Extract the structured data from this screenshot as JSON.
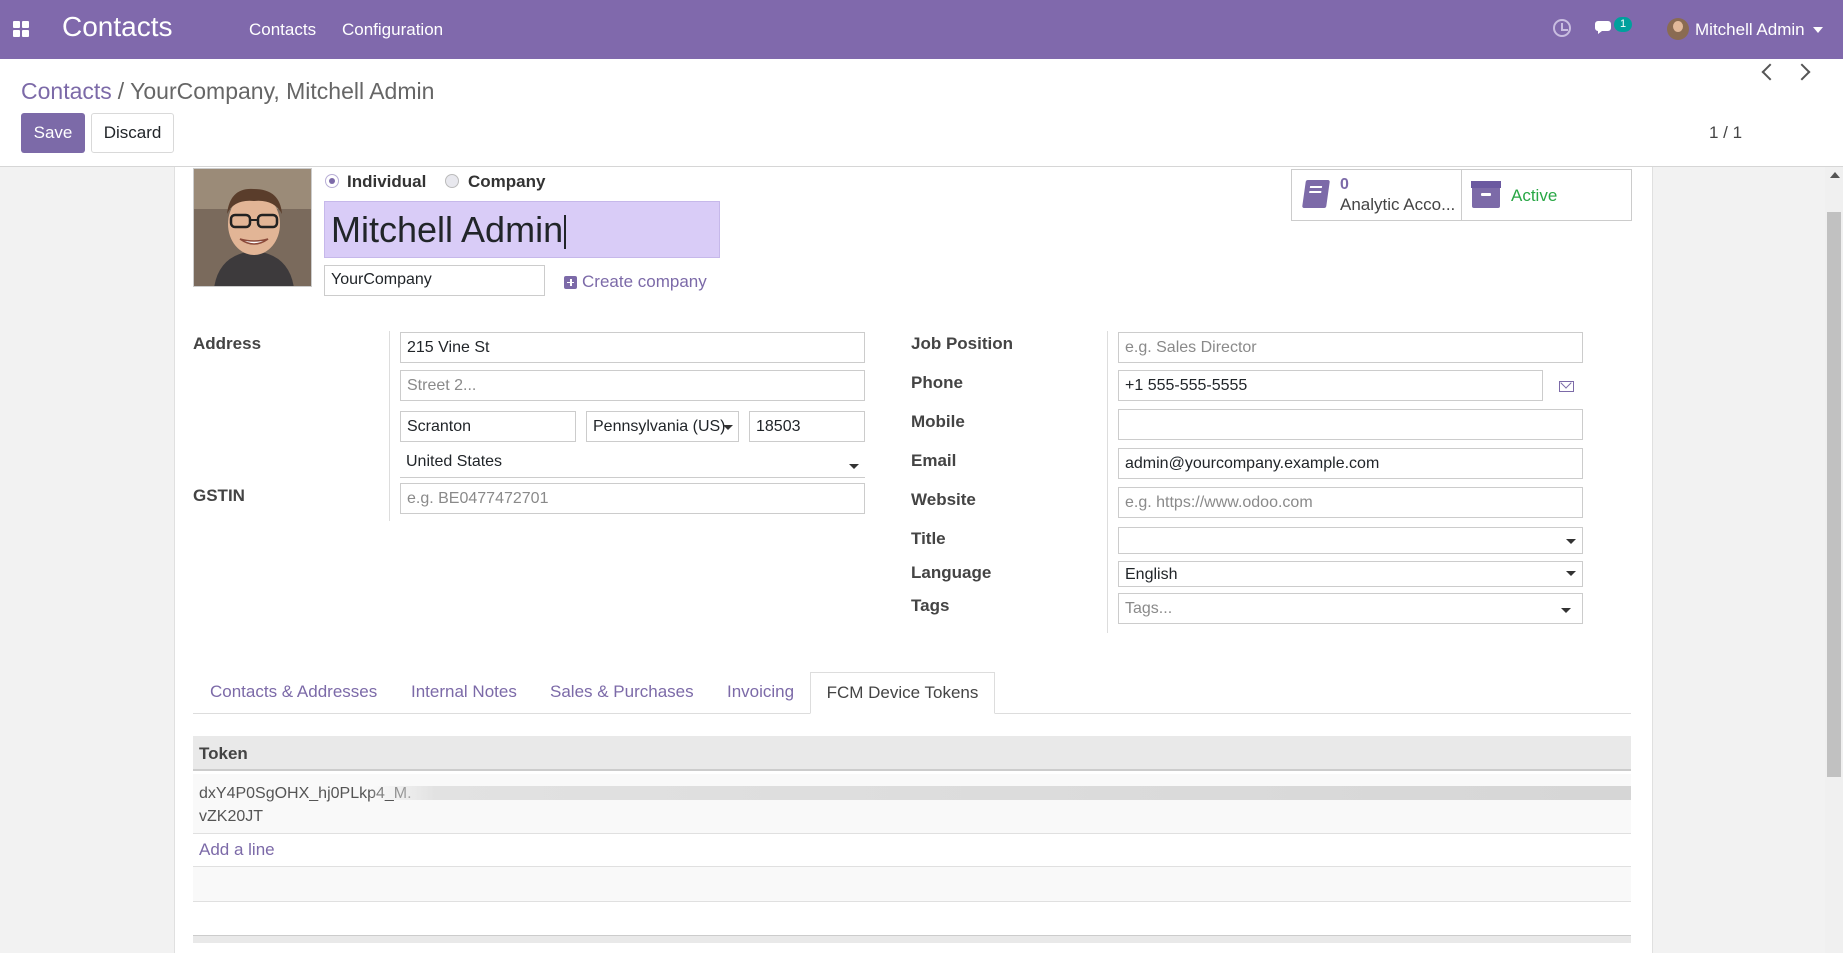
{
  "navbar": {
    "app_title": "Contacts",
    "menu": [
      "Contacts",
      "Configuration"
    ],
    "chat_badge": "1",
    "user_name": "Mitchell Admin",
    "bg_color": "#8069ac",
    "icons": [
      "apps-grid-icon",
      "clock-icon",
      "chat-icon",
      "caret-down-icon"
    ]
  },
  "control_panel": {
    "breadcrumb": {
      "root": "Contacts",
      "separator": "/",
      "current": "YourCompany, Mitchell Admin"
    },
    "save_label": "Save",
    "discard_label": "Discard",
    "pager": "1 / 1"
  },
  "form": {
    "company_type": {
      "options": [
        "Individual",
        "Company"
      ],
      "selected": "Individual"
    },
    "name": "Mitchell Admin",
    "parent_company": "YourCompany",
    "create_company_label": "Create company",
    "smart_buttons": {
      "analytic_count": "0",
      "analytic_label": "Analytic Acco...",
      "active_label": "Active"
    },
    "left": {
      "address_label": "Address",
      "street": "215 Vine St",
      "street2_placeholder": "Street 2...",
      "city": "Scranton",
      "state": "Pennsylvania (US)",
      "zip": "18503",
      "country": "United States",
      "gstin_label": "GSTIN",
      "gstin_placeholder": "e.g. BE0477472701"
    },
    "right": {
      "job_position_label": "Job Position",
      "job_position_placeholder": "e.g. Sales Director",
      "phone_label": "Phone",
      "phone": "+1 555-555-5555",
      "mobile_label": "Mobile",
      "mobile": "",
      "email_label": "Email",
      "email": "admin@yourcompany.example.com",
      "website_label": "Website",
      "website_placeholder": "e.g. https://www.odoo.com",
      "title_label": "Title",
      "title": "",
      "language_label": "Language",
      "language": "English",
      "tags_label": "Tags",
      "tags_placeholder": "Tags..."
    }
  },
  "tabs": [
    {
      "label": "Contacts & Addresses",
      "active": false
    },
    {
      "label": "Internal Notes",
      "active": false
    },
    {
      "label": "Sales & Purchases",
      "active": false
    },
    {
      "label": "Invoicing",
      "active": false
    },
    {
      "label": "FCM Device Tokens",
      "active": true
    }
  ],
  "tokens_table": {
    "header": "Token",
    "rows": [
      {
        "token_start": "dxY4P0SgOHX_hj0PLkp4_M.",
        "token_end": "vZK20JT"
      }
    ],
    "add_line_label": "Add a line"
  },
  "colors": {
    "accent": "#7c6aa8",
    "active_green": "#28a745",
    "name_highlight": "#d9ccf7"
  }
}
